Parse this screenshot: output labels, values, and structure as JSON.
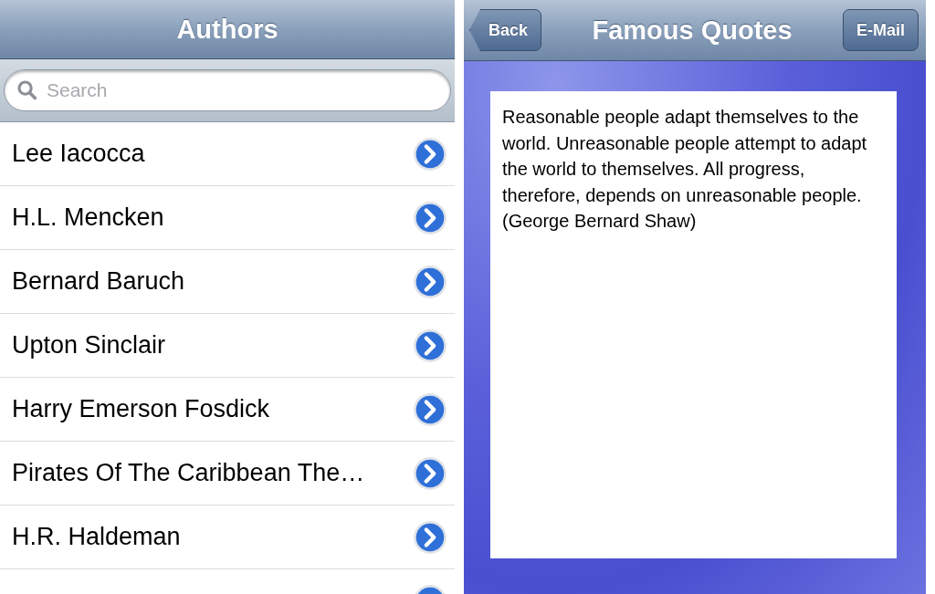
{
  "authors_screen": {
    "title": "Authors",
    "search": {
      "placeholder": "Search"
    },
    "rows": [
      {
        "name": "Lee Iacocca"
      },
      {
        "name": "H.L. Mencken"
      },
      {
        "name": "Bernard Baruch"
      },
      {
        "name": "Upton Sinclair"
      },
      {
        "name": "Harry Emerson Fosdick"
      },
      {
        "name": "Pirates Of The Caribbean The…"
      },
      {
        "name": "H.R. Haldeman"
      }
    ]
  },
  "quote_screen": {
    "back_button": "Back",
    "title": "Famous Quotes",
    "action_button": "E-Mail",
    "quote": "Reasonable people adapt themselves to the world. Unreasonable people attempt to adapt the world to themselves. All progress, therefore, depends on unreasonable people.",
    "attribution": "(George Bernard Shaw)"
  }
}
